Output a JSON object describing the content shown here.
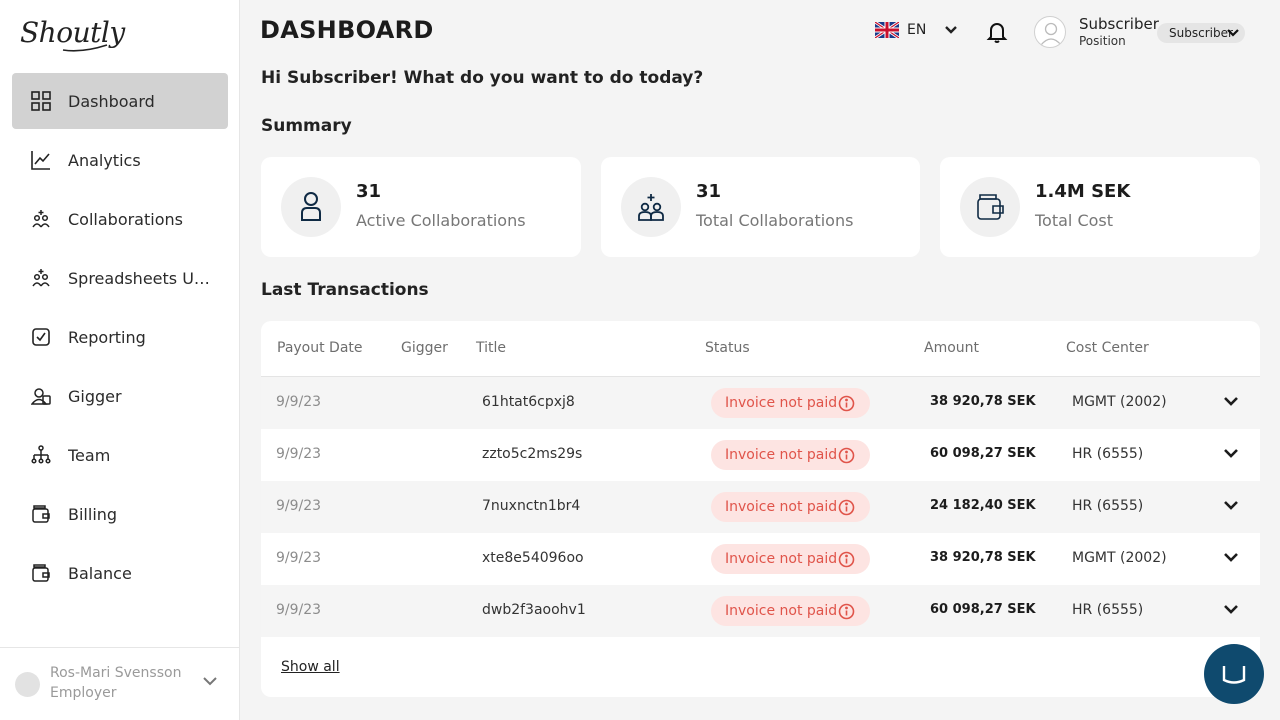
{
  "brand": {
    "logo_text": "Shoutly"
  },
  "sidebar": {
    "items": [
      {
        "label": "Dashboard",
        "icon": "grid-icon",
        "active": true
      },
      {
        "label": "Analytics",
        "icon": "line-chart-icon"
      },
      {
        "label": "Collaborations",
        "icon": "people-plus-icon"
      },
      {
        "label": "Spreadsheets Uploads",
        "icon": "people-plus-icon"
      },
      {
        "label": "Reporting",
        "icon": "checkbox-icon"
      },
      {
        "label": "Gigger",
        "icon": "user-card-icon"
      },
      {
        "label": "Team",
        "icon": "org-chart-icon"
      },
      {
        "label": "Billing",
        "icon": "wallet-icon"
      },
      {
        "label": "Balance",
        "icon": "wallet-icon"
      }
    ],
    "account": {
      "name": "Ros-Mari Svensson",
      "role": "Employer"
    }
  },
  "header": {
    "title": "DASHBOARD",
    "language": "EN",
    "user": {
      "name": "Subscriber",
      "position": "Position",
      "role_select": "Subscriber"
    }
  },
  "greeting": "Hi Subscriber! What do you want to do today?",
  "summary": {
    "title": "Summary",
    "cards": [
      {
        "value": "31",
        "caption": "Active Collaborations",
        "icon": "person-icon"
      },
      {
        "value": "31",
        "caption": "Total Collaborations",
        "icon": "people-plus-icon"
      },
      {
        "value": "1.4M SEK",
        "caption": "Total Cost",
        "icon": "wallet-icon"
      }
    ]
  },
  "transactions": {
    "title": "Last Transactions",
    "columns": [
      "Payout Date",
      "Gigger",
      "Title",
      "Status",
      "Amount",
      "Cost Center"
    ],
    "rows": [
      {
        "date": "9/9/23",
        "gigger": "",
        "title": "61htat6cpxj8",
        "status": "Invoice not paid",
        "amount": "38 920,78 SEK",
        "cost_center": "MGMT (2002)"
      },
      {
        "date": "9/9/23",
        "gigger": "",
        "title": "zzto5c2ms29s",
        "status": "Invoice not paid",
        "amount": "60 098,27 SEK",
        "cost_center": "HR (6555)"
      },
      {
        "date": "9/9/23",
        "gigger": "",
        "title": "7nuxnctn1br4",
        "status": "Invoice not paid",
        "amount": "24 182,40 SEK",
        "cost_center": "HR (6555)"
      },
      {
        "date": "9/9/23",
        "gigger": "",
        "title": "xte8e54096oo",
        "status": "Invoice not paid",
        "amount": "38 920,78 SEK",
        "cost_center": "MGMT (2002)"
      },
      {
        "date": "9/9/23",
        "gigger": "",
        "title": "dwb2f3aoohv1",
        "status": "Invoice not paid",
        "amount": "60 098,27 SEK",
        "cost_center": "HR (6555)"
      }
    ],
    "show_all": "Show all"
  },
  "colors": {
    "active_nav": "#d2d2d2",
    "badge_bg": "#fde4e2",
    "badge_text": "#e0544a",
    "chat": "#0f4a6e"
  }
}
